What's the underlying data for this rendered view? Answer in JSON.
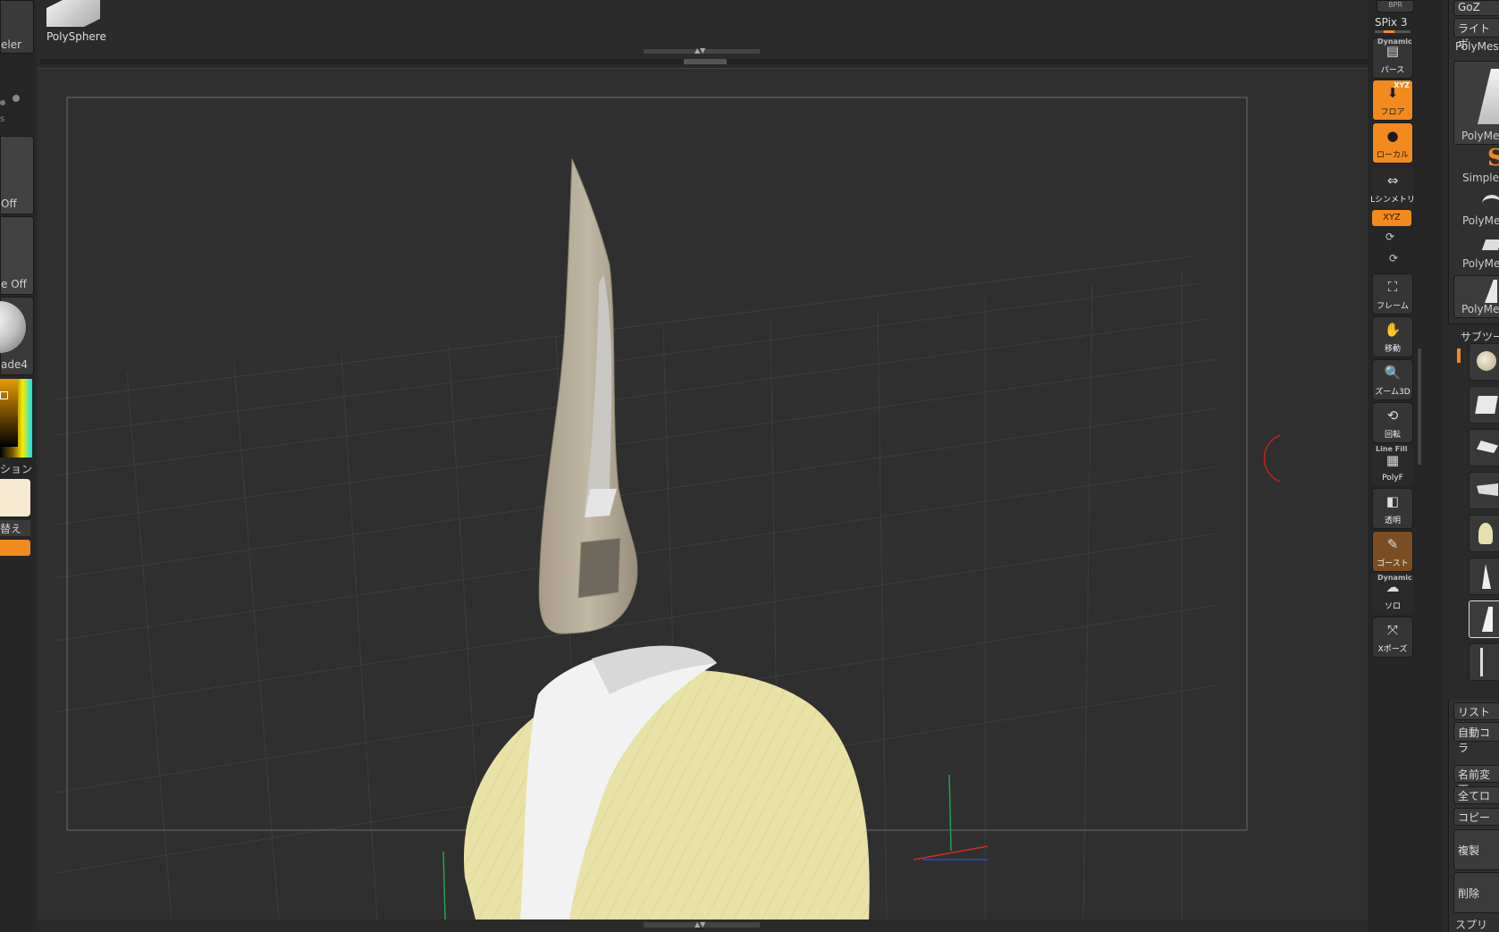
{
  "top_shelf": {
    "polysphere_label": "PolySphere",
    "spix_label": "SPix 3",
    "bpr_label": "BPR"
  },
  "left_shelf": {
    "modeler_label": "eler",
    "s_label": "s",
    "off1_label": "Off",
    "off2_label": "e Off",
    "material_label": "ade4",
    "colorization_label": "ション",
    "swap_label": "替え"
  },
  "tool_strip": {
    "persp": {
      "small": "Dynamic",
      "label": "パース"
    },
    "floor": {
      "small": "XYZ",
      "label": "フロア"
    },
    "local": {
      "label": "ローカル"
    },
    "lsym": {
      "label": "Lシンメトリ"
    },
    "xyz": {
      "label": "XYZ"
    },
    "frame": {
      "label": "フレーム"
    },
    "move": {
      "label": "移動"
    },
    "zoom3d": {
      "label": "ズーム3D"
    },
    "rotate": {
      "label": "回転"
    },
    "polyf": {
      "small": "Line Fill",
      "label": "PolyF"
    },
    "transp": {
      "label": "透明"
    },
    "ghost": {
      "label": "ゴースト"
    },
    "solo": {
      "small": "Dynamic",
      "label": "ソロ"
    },
    "xpose": {
      "label": "Xポーズ"
    }
  },
  "right_panel": {
    "goz_label": "GoZ",
    "lightbox_label": "ライトボ",
    "polymesh_label": "PolyMes",
    "tool_thumbs": [
      {
        "label": "PolyMes"
      },
      {
        "label": "SimpleB"
      },
      {
        "label": "PolyMes"
      },
      {
        "label": "PolyMes"
      },
      {
        "label": "PolyMes"
      }
    ],
    "subtool_header": "サブツー",
    "list_label": "リスト表",
    "autocollapse_label": "自動コラ",
    "rename_label": "名前変更",
    "allload_label": "全てロー",
    "copy_label": "コピー",
    "duplicate_label": "複製",
    "delete_label": "削除",
    "split_label": "スプリ"
  },
  "colors": {
    "accent": "#f28a1e",
    "background": "#2f2f2f",
    "hair": "#e8e2a6",
    "horn": "#b7ad9a"
  }
}
